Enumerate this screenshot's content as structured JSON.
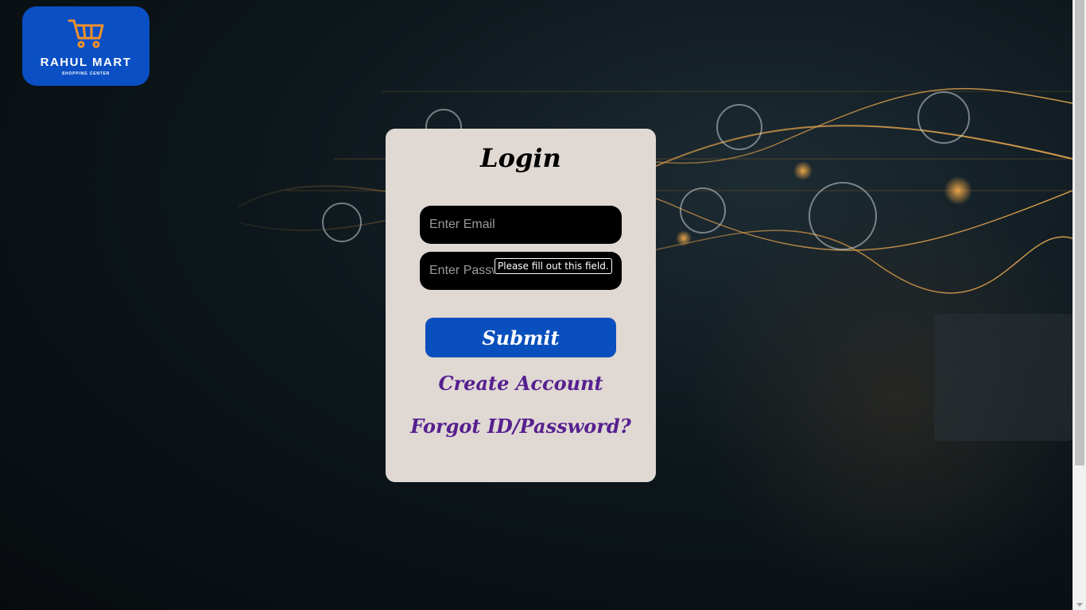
{
  "logo": {
    "icon": "shopping-cart-icon",
    "brand": "RAHUL MART",
    "tagline": "SHOPPING CENTER"
  },
  "login": {
    "title": "Login",
    "email_placeholder": "Enter Email",
    "password_placeholder": "Enter Password",
    "submit_label": "Submit",
    "create_account_label": "Create Account",
    "forgot_label": "Forgot ID/Password?"
  },
  "validation_tooltip": "Please fill out this field.",
  "colors": {
    "brand_blue": "#0a4fc4",
    "card_bg": "#e0d8d3",
    "link_purple": "#56208f",
    "field_bg": "#000000"
  }
}
